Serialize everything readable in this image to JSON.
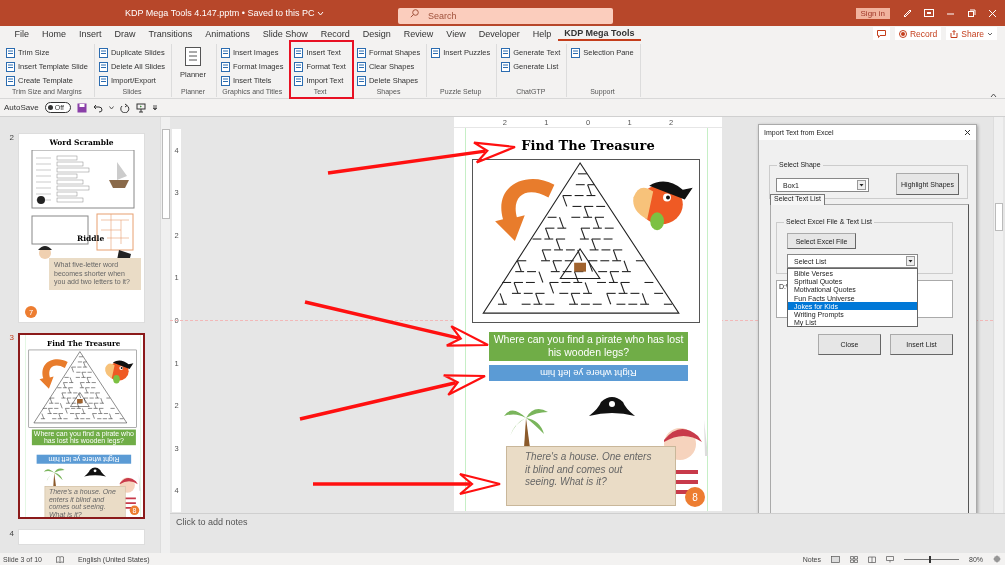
{
  "window": {
    "title": "KDP Mega Tools 4.147.pptm • Saved to this PC",
    "search": {
      "placeholder": "Search"
    },
    "sign_in": "Sign in"
  },
  "menu_tabs": [
    {
      "label": "File",
      "selected": false
    },
    {
      "label": "Home",
      "selected": false
    },
    {
      "label": "Insert",
      "selected": false
    },
    {
      "label": "Draw",
      "selected": false
    },
    {
      "label": "Transitions",
      "selected": false
    },
    {
      "label": "Animations",
      "selected": false
    },
    {
      "label": "Slide Show",
      "selected": false
    },
    {
      "label": "Record",
      "selected": false
    },
    {
      "label": "Design",
      "selected": false
    },
    {
      "label": "Review",
      "selected": false
    },
    {
      "label": "View",
      "selected": false
    },
    {
      "label": "Developer",
      "selected": false
    },
    {
      "label": "Help",
      "selected": false
    },
    {
      "label": "KDP Mega Tools",
      "selected": true
    }
  ],
  "actions": {
    "record": "Record",
    "share": "Share"
  },
  "ribbon_groups": [
    {
      "label": "Trim Size and Margins",
      "highlighted": false,
      "items": [
        {
          "label": "Trim Size",
          "kind": "small"
        },
        {
          "label": "Insert Template Slide",
          "kind": "small"
        },
        {
          "label": "Create Template",
          "kind": "small"
        }
      ]
    },
    {
      "label": "Slides",
      "highlighted": false,
      "items": [
        {
          "label": "Duplicate Slides",
          "kind": "small"
        },
        {
          "label": "Delete All Slides",
          "kind": "small"
        },
        {
          "label": "Import/Export",
          "kind": "small"
        }
      ]
    },
    {
      "label": "Planner",
      "highlighted": false,
      "items": [
        {
          "label": "Planner",
          "kind": "large"
        }
      ]
    },
    {
      "label": "Graphics and Titles",
      "highlighted": false,
      "items": [
        {
          "label": "Insert Images",
          "kind": "small"
        },
        {
          "label": "Format Images",
          "kind": "small"
        },
        {
          "label": "Insert Titels",
          "kind": "small"
        }
      ]
    },
    {
      "label": "Text",
      "highlighted": true,
      "items": [
        {
          "label": "Insert Text",
          "kind": "small"
        },
        {
          "label": "Format Text",
          "kind": "small"
        },
        {
          "label": "Import Text",
          "kind": "small"
        }
      ]
    },
    {
      "label": "Shapes",
      "highlighted": false,
      "items": [
        {
          "label": "Format Shapes",
          "kind": "small"
        },
        {
          "label": "Clear Shapes",
          "kind": "small"
        },
        {
          "label": "Delete Shapes",
          "kind": "small"
        }
      ]
    },
    {
      "label": "Puzzle Setup",
      "highlighted": false,
      "items": [
        {
          "label": "Insert Puzzles",
          "kind": "small"
        }
      ]
    },
    {
      "label": "ChatGTP",
      "highlighted": false,
      "items": [
        {
          "label": "Generate Text",
          "kind": "small"
        },
        {
          "label": "Generate List",
          "kind": "small"
        }
      ]
    },
    {
      "label": "Support",
      "highlighted": false,
      "items": [
        {
          "label": "Selection Pane",
          "kind": "small"
        }
      ]
    }
  ],
  "quick_access": {
    "autosave_label": "AutoSave",
    "autosave": {
      "on": false,
      "label": "Off"
    }
  },
  "thumbnails": [
    {
      "number": "2",
      "kind": "scramble",
      "selected": false,
      "title": "Word Scramble",
      "subtitle": "Riddle",
      "riddle": "What five-letter word becomes shorter when you add two letters to it?",
      "page": "7"
    },
    {
      "number": "3",
      "kind": "treasure",
      "selected": true,
      "slide": {
        "title": "Find The Treasure",
        "question": "Where can you find a pirate who has lost his wooden legs?",
        "answer": "Right where ye left him",
        "riddle": "There's a house. One enters it blind and comes out seeing. What is it?",
        "page": "8"
      }
    },
    {
      "number": "4",
      "kind": "blank",
      "selected": false
    }
  ],
  "rulers": {
    "horizontal": [
      "2",
      "1",
      "0",
      "1",
      "2"
    ],
    "vertical": [
      "4",
      "3",
      "2",
      "1",
      "0",
      "1",
      "2",
      "3",
      "4"
    ]
  },
  "slide": {
    "title": "Find The Treasure",
    "question": "Where can you find a pirate who has lost his wooden legs?",
    "answer": "Right where ye left him",
    "riddle": "There's a house. One enters it blind and comes out seeing. What is it?",
    "page": "8"
  },
  "dialog": {
    "title": "Import Text from Excel",
    "shape_group": "Select Shape",
    "shape_value": "Box1",
    "highlight_button": "Highlight Shapes",
    "tabs": [
      {
        "label": "Select Text List",
        "selected": true
      }
    ],
    "file_group": "Select Excel File & Text List",
    "file_button": "Select Excel File",
    "list_value": "Select List",
    "expanded": true,
    "list_options": [
      {
        "label": "Bible Verses",
        "selected": false
      },
      {
        "label": "Spritual Quotes",
        "selected": false
      },
      {
        "label": "Motivational Quotes",
        "selected": false
      },
      {
        "label": "Fun Facts Universe",
        "selected": false
      },
      {
        "label": "Jokes for Kids",
        "selected": true
      },
      {
        "label": "Writing Prompts",
        "selected": false
      },
      {
        "label": "My List",
        "selected": false
      }
    ],
    "path": "D:\\",
    "buttons": [
      "Close",
      "Insert List"
    ]
  },
  "notes_prompt": "Click to add notes",
  "status_bar": {
    "slide_info": "Slide 3 of 10",
    "language": "English (United States)",
    "notes": "Notes",
    "zoom": {
      "level": 0.45,
      "label": "80%"
    }
  }
}
